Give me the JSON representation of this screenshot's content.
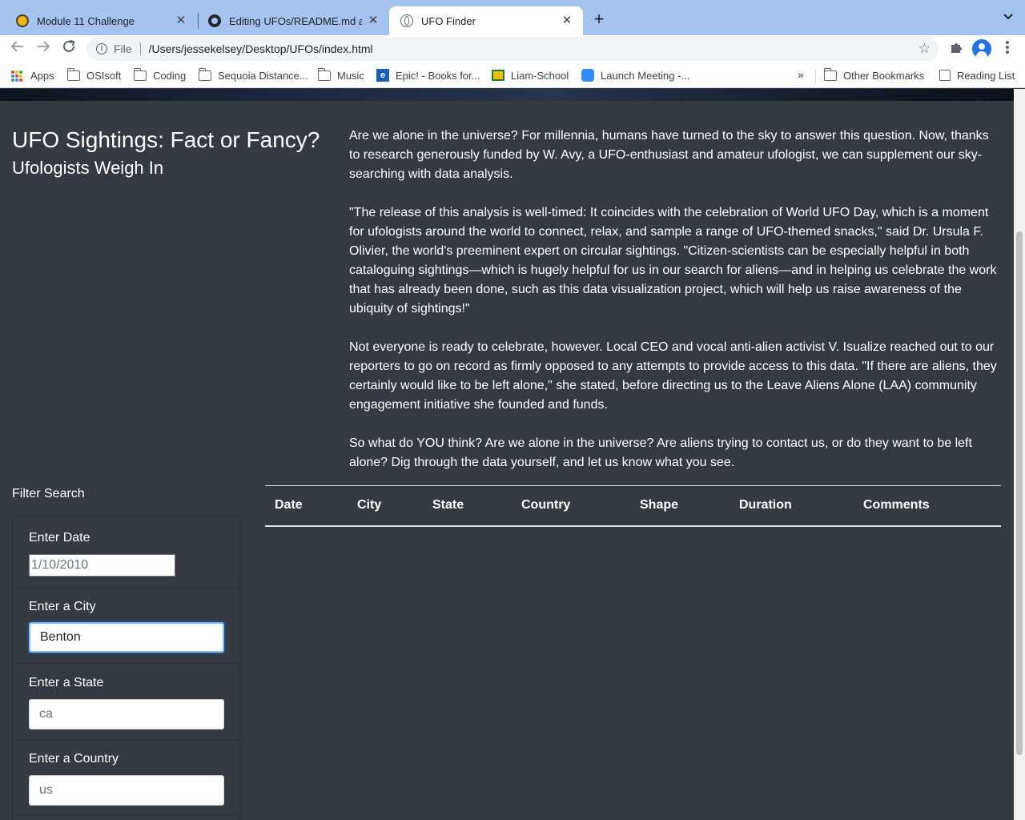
{
  "browser": {
    "tabs": [
      {
        "title": "Module 11 Challenge",
        "active": false,
        "favicon": "module-favicon"
      },
      {
        "title": "Editing UFOs/README.md at m",
        "active": false,
        "favicon": "github-icon"
      },
      {
        "title": "UFO Finder",
        "active": true,
        "favicon": "globe-icon"
      }
    ],
    "tab_close_glyph": "✕",
    "new_tab_glyph": "+",
    "url_scheme": "File",
    "url": "/Users/jessekelsey/Desktop/UFOs/index.html",
    "bookmarks": [
      {
        "label": "Apps",
        "icon": "apps-grid-icon"
      },
      {
        "label": "OSIsoft",
        "icon": "folder-icon"
      },
      {
        "label": "Coding",
        "icon": "folder-icon"
      },
      {
        "label": "Sequoia Distance...",
        "icon": "folder-icon"
      },
      {
        "label": "Music",
        "icon": "folder-icon"
      },
      {
        "label": "Epic! - Books for...",
        "icon": "epic-icon"
      },
      {
        "label": "Liam-School",
        "icon": "classroom-icon"
      },
      {
        "label": "Launch Meeting -...",
        "icon": "zoom-icon"
      }
    ],
    "bookmarks_more_glyph": "»",
    "other_bookmarks": "Other Bookmarks",
    "reading_list": "Reading List"
  },
  "page": {
    "title": "UFO Sightings: Fact or Fancy?",
    "subtitle": "Ufologists Weigh In",
    "article_paragraphs": [
      "Are we alone in the universe? For millennia, humans have turned to the sky to answer this question. Now, thanks to research generously funded by W. Avy, a UFO-enthusiast and amateur ufologist, we can supplement our sky-searching with data analysis.",
      "\"The release of this analysis is well-timed: It coincides with the celebration of World UFO Day, which is a moment for ufologists around the world to connect, relax, and sample a range of UFO-themed snacks,\" said Dr. Ursula F. Olivier, the world's preeminent expert on circular sightings. \"Citizen-scientists can be especially helpful in both cataloguing sightings—which is hugely helpful for us in our search for aliens—and in helping us celebrate the work that has already been done, such as this data visualization project, which will help us raise awareness of the ubiquity of sightings!\"",
      "Not everyone is ready to celebrate, however. Local CEO and vocal anti-alien activist V. Isualize reached out to our reporters to go on record as firmly opposed to any attempts to provide access to this data. \"If there are aliens, they certainly would like to be left alone,\" she stated, before directing us to the Leave Aliens Alone (LAA) community engagement initiative she founded and funds.",
      "So what do YOU think? Are we alone in the universe? Are aliens trying to contact us, or do they want to be left alone? Dig through the data yourself, and let us know what you see."
    ],
    "filter": {
      "heading": "Filter Search",
      "date": {
        "label": "Enter Date",
        "placeholder": "1/10/2010",
        "value": ""
      },
      "city": {
        "label": "Enter a City",
        "placeholder": "",
        "value": "Benton"
      },
      "state": {
        "label": "Enter a State",
        "placeholder": "ca",
        "value": ""
      },
      "country": {
        "label": "Enter a Country",
        "placeholder": "us",
        "value": ""
      }
    },
    "table": {
      "headers": [
        "Date",
        "City",
        "State",
        "Country",
        "Shape",
        "Duration",
        "Comments"
      ],
      "rows": []
    }
  }
}
